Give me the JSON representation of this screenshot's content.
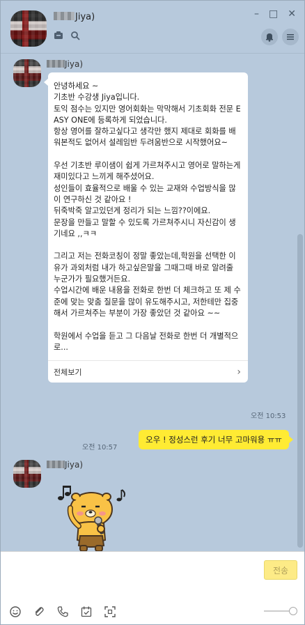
{
  "header": {
    "name_suffix": "Jiya)"
  },
  "window": {
    "minimize": "–",
    "maximize": "□",
    "close": "✕"
  },
  "messages": [
    {
      "sender_suffix": "Jiya)",
      "text": "안녕하세요 ~\n기초반 수강생 Jiya입니다.\n토익 점수는 있지만 영어회화는 막막해서 기초회화 전문 EASY ONE에 등록하게 되었습니다.\n항상 영어를 잘하고싶다고 생각만 했지 제대로 회화를 배워본적도 없어서 설레임반 두려움반으로 시작했어요~\n\n우선 기초반 루이샘이 쉽게 가르쳐주시고 영어로 말하는게 재미있다고 느끼게 해주셨어요.\n성인들이 효율적으로 배울 수 있는 교재와 수업방식을 많이 연구하신 것 같아요 !\n뒤죽박죽 알고있던게 정리가 되는 느낌??이에요.\n문장을 만들고 말할 수 있도록 가르쳐주시니 자신감이 생기네요 ,,ㅋㅋ\n\n그리고 저는 전화코칭이 정말 좋았는데,학원을 선택한 이유가 과외처럼 내가 하고싶은말을 그때그때 바로 알려줄 누군가가 필요했거든요.\n수업시간에 배운 내용을 전화로 한번 더 체크하고 또 제 수준에 맞는 맞춤 질문을 많이 유도해주시고, 저한테만 집중해서 가르쳐주는 부분이 가장 좋았던 것 같아요 ~~\n\n학원에서 수업을 듣고 그 다음날 전화로 한번 더 개별적으로...",
      "more_label": "전체보기",
      "time": "오전 10:53"
    },
    {
      "text": "오우 ! 정성스런 후기 너무 고마워용 ㅠㅠ",
      "time": "오전 10:57"
    },
    {
      "sender_suffix": "Jiya)"
    }
  ],
  "input": {
    "send_label": "전송"
  },
  "icons": [
    "chat-icon",
    "search-icon",
    "bell-icon",
    "menu-icon",
    "emoji-icon",
    "attach-icon",
    "phone-icon",
    "calendar-icon",
    "capture-icon"
  ],
  "colors": {
    "background": "#b7c9dc",
    "my_bubble": "#ffeb33",
    "send_button": "#fdeb87"
  }
}
